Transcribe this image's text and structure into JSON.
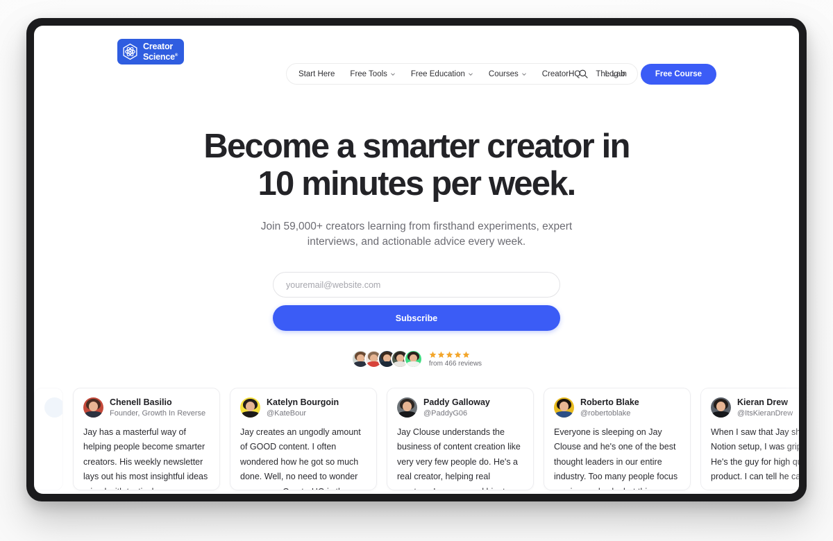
{
  "brand": {
    "logo_line1": "Creator",
    "logo_line2": "Science",
    "logo_mark": "atom-hexagon-icon",
    "accent_blue": "#3b5cf6",
    "logo_blue": "#2f5de0",
    "star_gold": "#f3a62b"
  },
  "nav": {
    "items": [
      {
        "label": "Start Here",
        "has_caret": false
      },
      {
        "label": "Free Tools",
        "has_caret": true
      },
      {
        "label": "Free Education",
        "has_caret": true
      },
      {
        "label": "Courses",
        "has_caret": true
      },
      {
        "label": "CreatorHQ",
        "has_caret": false
      },
      {
        "label": "The Lab",
        "has_caret": false
      }
    ],
    "search_icon": "search-icon",
    "login_label": "Log in",
    "cta_label": "Free Course"
  },
  "hero": {
    "headline_line1": "Become a smarter creator in",
    "headline_line2": "10 minutes per week.",
    "subheadline": "Join 59,000+ creators learning from firsthand experiments, expert interviews, and actionable advice every week.",
    "email_placeholder": "youremail@website.com",
    "email_value": "",
    "subscribe_label": "Subscribe",
    "stars": 5,
    "reviews_text": "from 466 reviews",
    "avatar_count": 5
  },
  "testimonials": [
    {
      "name": "Chenell Basilio",
      "handle": "Founder, Growth In Reverse",
      "quote": "Jay has a masterful way of helping people become smarter creators. His weekly newsletter lays out his most insightful ideas mixed with tactical ways you can build a",
      "avatar_bg": "#c4493a",
      "hair": "#4a2d22",
      "body": "#2b3240"
    },
    {
      "name": "Katelyn Bourgoin",
      "handle": "@KateBour",
      "quote": "Jay creates an ungodly amount of GOOD content. I often wondered how he got so much done. Well, no need to wonder anymore—CreatorHQ is the answer. If you",
      "avatar_bg": "#f5e03c",
      "hair": "#241d1b",
      "body": "#1d1a19"
    },
    {
      "name": "Paddy Galloway",
      "handle": "@PaddyG06",
      "quote": "Jay Clouse understands the business of content creation like very very few people do. He's a real creator, helping real creators. I recommend him to people all the",
      "avatar_bg": "#6e7479",
      "hair": "#2d2622",
      "body": "#17181a"
    },
    {
      "name": "Roberto Blake",
      "handle": "@robertoblake",
      "quote": "Everyone is sleeping on Jay Clouse and he's one of the best thought leaders in our entire industry. Too many people focus on view and subs but this man drives",
      "avatar_bg": "#e8bb1e",
      "hair": "#1c1410",
      "body": "#2b4e86"
    },
    {
      "name": "Kieran Drew",
      "handle": "@ItsKieranDrew",
      "quote": "When I saw that Jay shared his Notion setup, I was gripped. He's the guy for high quality product. I can tell he care about",
      "avatar_bg": "#5a6068",
      "hair": "#241e1a",
      "body": "#16181b"
    }
  ]
}
